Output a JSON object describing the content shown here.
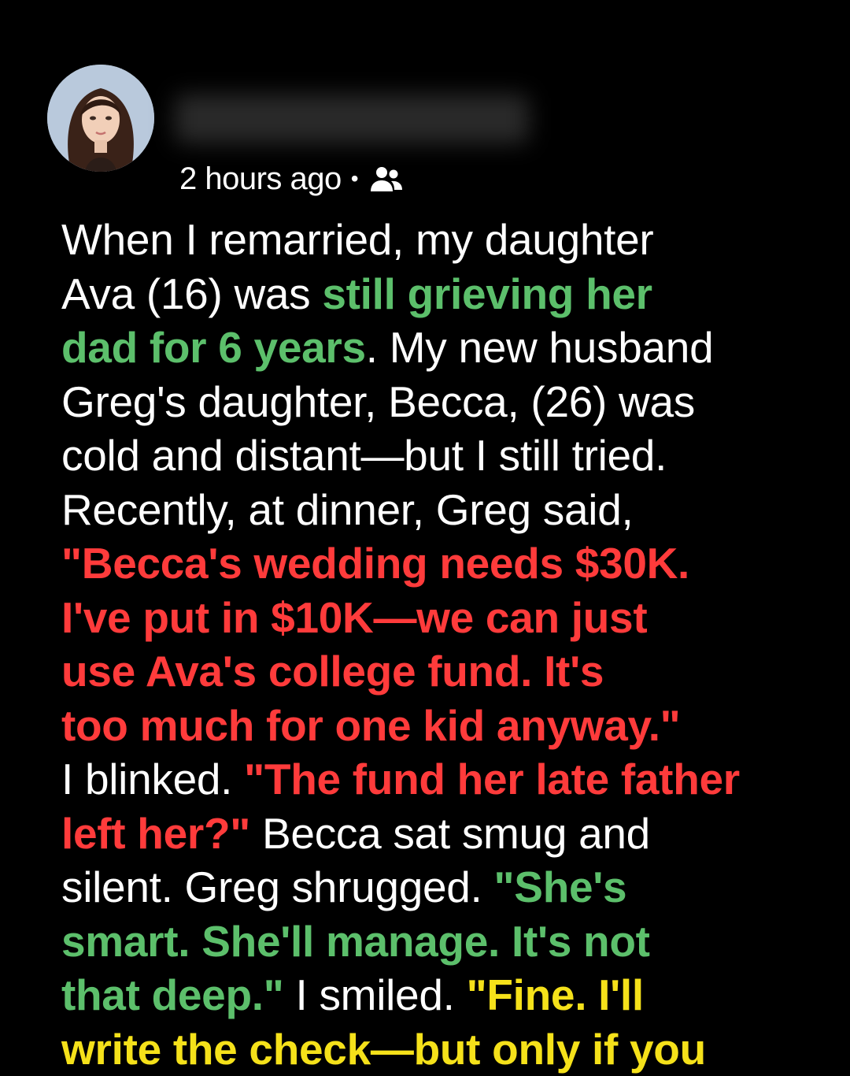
{
  "post": {
    "timestamp": "2 hours ago",
    "separator": "•",
    "audience_icon": "friends-icon",
    "author_name_blurred": true
  },
  "story": {
    "segments": [
      {
        "text": "When I remarried, my daughter\nAva (16) was ",
        "style": "plain"
      },
      {
        "text": "still grieving her\ndad for 6 years",
        "style": "green"
      },
      {
        "text": ". My new husband\nGreg's daughter, Becca, (26) was\ncold and distant—but I still tried.\nRecently, at dinner, Greg said,\n",
        "style": "plain"
      },
      {
        "text": "\"Becca's wedding needs $30K.\nI've put in $10K—we can just\nuse Ava's college fund. It's\ntoo much for one kid anyway.\"",
        "style": "red"
      },
      {
        "text": "\nI blinked. ",
        "style": "plain"
      },
      {
        "text": "\"The fund her late father\nleft her?\"",
        "style": "red"
      },
      {
        "text": " Becca sat smug and\nsilent. Greg shrugged. ",
        "style": "plain"
      },
      {
        "text": "\"She's\nsmart. She'll manage. It's not\nthat deep.\"",
        "style": "green"
      },
      {
        "text": " I smiled. ",
        "style": "plain"
      },
      {
        "text": "\"Fine. I'll\nwrite the check—but only if you",
        "style": "yellow"
      }
    ]
  },
  "colors": {
    "background": "#000000",
    "text": "#ffffff",
    "green": "#5cbf6b",
    "red": "#ff3b3b",
    "yellow": "#f5e11a"
  }
}
